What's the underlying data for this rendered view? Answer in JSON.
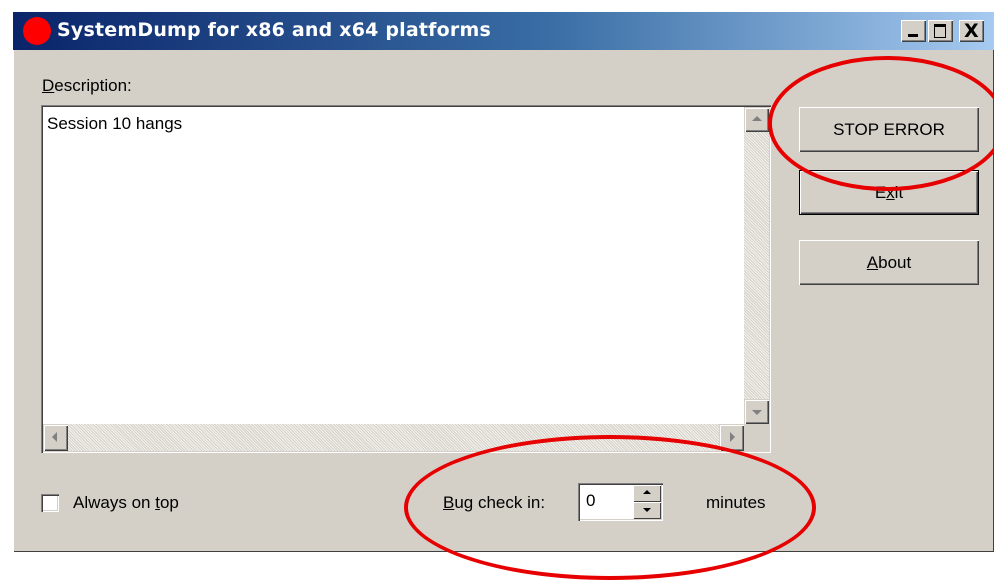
{
  "window": {
    "title": "SystemDump for x86 and x64 platforms",
    "close_glyph": "X"
  },
  "description": {
    "label_access": "D",
    "label_rest": "escription:",
    "text": "Session 10 hangs"
  },
  "buttons": {
    "stop_error": "STOP ERROR",
    "exit_before": "E",
    "exit_access": "x",
    "exit_after": "it",
    "about_access": "A",
    "about_rest": "bout"
  },
  "always_on_top": {
    "label_before": "Always on ",
    "label_access": "t",
    "label_after": "op",
    "checked": false
  },
  "bug_check": {
    "label_access": "B",
    "label_rest": "ug check in:",
    "value": "0",
    "unit": "minutes"
  },
  "colors": {
    "title_gradient_start": "#0a246a",
    "title_gradient_end": "#a6caf0",
    "window_face": "#d4d0c8",
    "app_icon": "#ff0000",
    "annotation": "#e60000"
  },
  "icons": [
    "app-icon",
    "minimize-icon",
    "maximize-icon",
    "close-icon",
    "scroll-up-icon",
    "scroll-down-icon",
    "scroll-left-icon",
    "scroll-right-icon",
    "spin-up-icon",
    "spin-down-icon"
  ]
}
